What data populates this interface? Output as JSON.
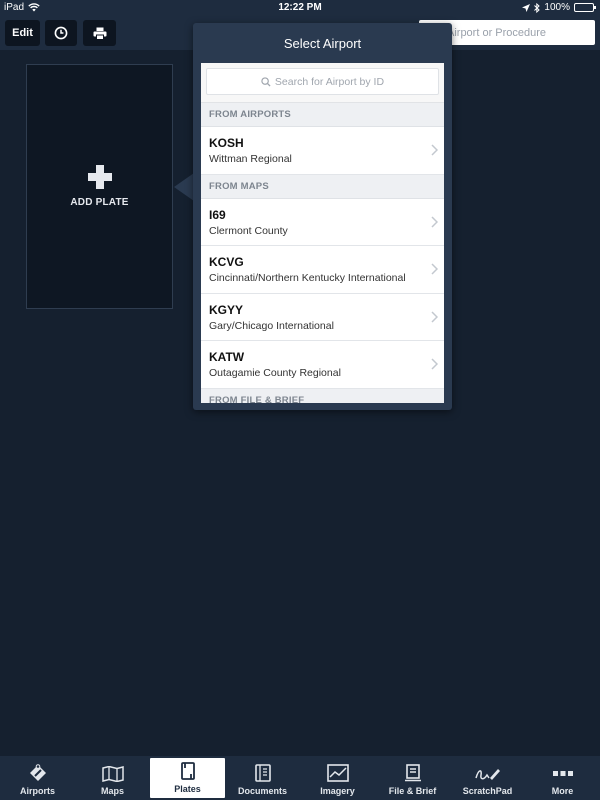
{
  "status_bar": {
    "device": "iPad",
    "time": "12:22 PM",
    "battery": "100%",
    "battery_level": 1.0
  },
  "toolbar": {
    "edit_label": "Edit",
    "search_placeholder": "Airport or Procedure"
  },
  "plate": {
    "add_label": "ADD PLATE"
  },
  "popover": {
    "title": "Select Airport",
    "search_placeholder": "Search for Airport by ID",
    "sections": [
      {
        "header": "FROM AIRPORTS",
        "items": [
          {
            "id": "KOSH",
            "name": "Wittman Regional"
          }
        ]
      },
      {
        "header": "FROM MAPS",
        "items": [
          {
            "id": "I69",
            "name": "Clermont County"
          },
          {
            "id": "KCVG",
            "name": "Cincinnati/Northern Kentucky International"
          },
          {
            "id": "KGYY",
            "name": "Gary/Chicago International"
          },
          {
            "id": "KATW",
            "name": "Outagamie County Regional"
          }
        ]
      },
      {
        "header": "FROM FILE & BRIEF",
        "items": []
      }
    ]
  },
  "tab_bar": {
    "active": "Plates",
    "tabs": [
      {
        "label": "Airports",
        "icon": "airports-icon"
      },
      {
        "label": "Maps",
        "icon": "maps-icon"
      },
      {
        "label": "Plates",
        "icon": "plates-icon"
      },
      {
        "label": "Documents",
        "icon": "documents-icon"
      },
      {
        "label": "Imagery",
        "icon": "imagery-icon"
      },
      {
        "label": "File & Brief",
        "icon": "file-brief-icon"
      },
      {
        "label": "ScratchPad",
        "icon": "scratchpad-icon"
      },
      {
        "label": "More",
        "icon": "more-icon"
      }
    ]
  }
}
